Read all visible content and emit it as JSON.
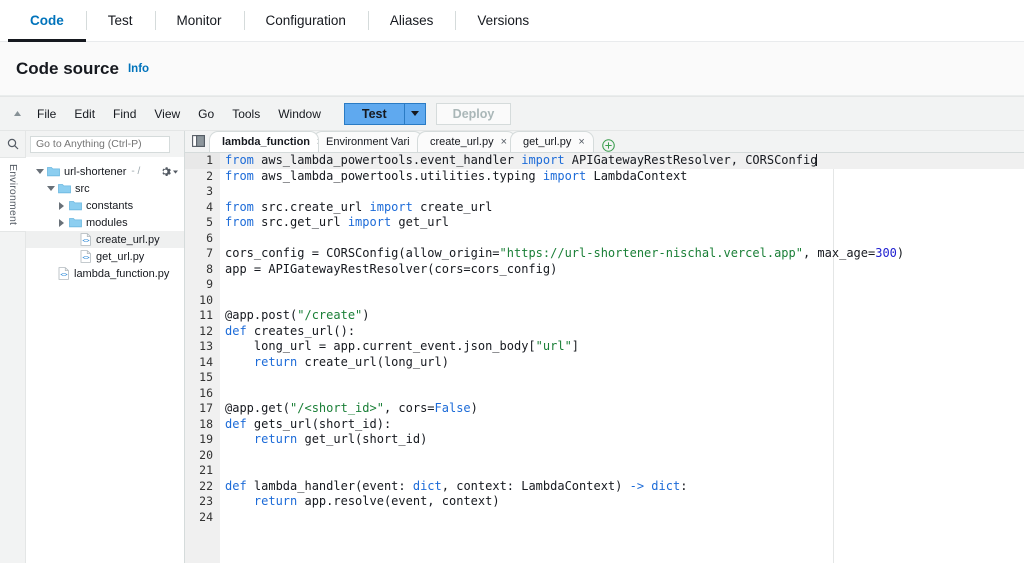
{
  "topnav": {
    "items": [
      {
        "label": "Code",
        "active": true
      },
      {
        "label": "Test",
        "active": false
      },
      {
        "label": "Monitor",
        "active": false
      },
      {
        "label": "Configuration",
        "active": false
      },
      {
        "label": "Aliases",
        "active": false
      },
      {
        "label": "Versions",
        "active": false
      }
    ]
  },
  "section": {
    "title": "Code source",
    "info_label": "Info"
  },
  "menubar": {
    "items": [
      "File",
      "Edit",
      "Find",
      "View",
      "Go",
      "Tools",
      "Window"
    ],
    "test_label": "Test",
    "deploy_label": "Deploy"
  },
  "rail": {
    "environment_label": "Environment"
  },
  "tree": {
    "search_placeholder": "Go to Anything (Ctrl-P)",
    "root": {
      "label": "url-shortener",
      "sub": "- /"
    },
    "items": [
      {
        "label": "src",
        "type": "folder",
        "depth": 1,
        "expanded": true,
        "selected": false
      },
      {
        "label": "constants",
        "type": "folder",
        "depth": 2,
        "expanded": false,
        "selected": false
      },
      {
        "label": "modules",
        "type": "folder",
        "depth": 2,
        "expanded": false,
        "selected": false
      },
      {
        "label": "create_url.py",
        "type": "file",
        "depth": 3,
        "expanded": false,
        "selected": true
      },
      {
        "label": "get_url.py",
        "type": "file",
        "depth": 3,
        "expanded": false,
        "selected": false
      },
      {
        "label": "lambda_function.py",
        "type": "file",
        "depth": 1,
        "expanded": false,
        "selected": false
      }
    ]
  },
  "editor": {
    "tabs": [
      {
        "label": "lambda_function",
        "active": true,
        "modified": false
      },
      {
        "label": "Environment Vari",
        "active": false,
        "modified": true
      },
      {
        "label": "create_url.py",
        "active": false,
        "modified": false
      },
      {
        "label": "get_url.py",
        "active": false,
        "modified": false
      }
    ],
    "add_tab_label": "+",
    "line_count": 24,
    "current_line": 1,
    "lines": [
      {
        "n": 1,
        "tokens": [
          {
            "t": "from ",
            "c": "kw"
          },
          {
            "t": "aws_lambda_powertools.event_handler ",
            "c": ""
          },
          {
            "t": "import ",
            "c": "kw"
          },
          {
            "t": "APIGatewayRestResolver, CORSConfig",
            "c": ""
          }
        ]
      },
      {
        "n": 2,
        "tokens": [
          {
            "t": "from ",
            "c": "kw"
          },
          {
            "t": "aws_lambda_powertools.utilities.typing ",
            "c": ""
          },
          {
            "t": "import ",
            "c": "kw"
          },
          {
            "t": "LambdaContext",
            "c": ""
          }
        ]
      },
      {
        "n": 3,
        "tokens": []
      },
      {
        "n": 4,
        "tokens": [
          {
            "t": "from ",
            "c": "kw"
          },
          {
            "t": "src.create_url ",
            "c": ""
          },
          {
            "t": "import ",
            "c": "kw"
          },
          {
            "t": "create_url",
            "c": ""
          }
        ]
      },
      {
        "n": 5,
        "tokens": [
          {
            "t": "from ",
            "c": "kw"
          },
          {
            "t": "src.get_url ",
            "c": ""
          },
          {
            "t": "import ",
            "c": "kw"
          },
          {
            "t": "get_url",
            "c": ""
          }
        ]
      },
      {
        "n": 6,
        "tokens": []
      },
      {
        "n": 7,
        "tokens": [
          {
            "t": "cors_config = CORSConfig(allow_origin=",
            "c": ""
          },
          {
            "t": "\"https://url-shortener-nischal.vercel.app\"",
            "c": "str"
          },
          {
            "t": ", max_age=",
            "c": ""
          },
          {
            "t": "300",
            "c": "num"
          },
          {
            "t": ")",
            "c": ""
          }
        ]
      },
      {
        "n": 8,
        "tokens": [
          {
            "t": "app = APIGatewayRestResolver(cors=cors_config)",
            "c": ""
          }
        ]
      },
      {
        "n": 9,
        "tokens": []
      },
      {
        "n": 10,
        "tokens": []
      },
      {
        "n": 11,
        "tokens": [
          {
            "t": "@app.post(",
            "c": ""
          },
          {
            "t": "\"/create\"",
            "c": "str"
          },
          {
            "t": ")",
            "c": ""
          }
        ]
      },
      {
        "n": 12,
        "tokens": [
          {
            "t": "def ",
            "c": "kw"
          },
          {
            "t": "creates_url",
            "c": "fn"
          },
          {
            "t": "():",
            "c": ""
          }
        ]
      },
      {
        "n": 13,
        "tokens": [
          {
            "t": "    long_url = app.current_event.json_body[",
            "c": ""
          },
          {
            "t": "\"url\"",
            "c": "str"
          },
          {
            "t": "]",
            "c": ""
          }
        ]
      },
      {
        "n": 14,
        "tokens": [
          {
            "t": "    ",
            "c": ""
          },
          {
            "t": "return ",
            "c": "kw"
          },
          {
            "t": "create_url(long_url)",
            "c": ""
          }
        ]
      },
      {
        "n": 15,
        "tokens": []
      },
      {
        "n": 16,
        "tokens": []
      },
      {
        "n": 17,
        "tokens": [
          {
            "t": "@app.get(",
            "c": ""
          },
          {
            "t": "\"/<short_id>\"",
            "c": "str"
          },
          {
            "t": ", cors=",
            "c": ""
          },
          {
            "t": "False",
            "c": "kw2"
          },
          {
            "t": ")",
            "c": ""
          }
        ]
      },
      {
        "n": 18,
        "tokens": [
          {
            "t": "def ",
            "c": "kw"
          },
          {
            "t": "gets_url",
            "c": "fn"
          },
          {
            "t": "(short_id):",
            "c": ""
          }
        ]
      },
      {
        "n": 19,
        "tokens": [
          {
            "t": "    ",
            "c": ""
          },
          {
            "t": "return ",
            "c": "kw"
          },
          {
            "t": "get_url(short_id)",
            "c": ""
          }
        ]
      },
      {
        "n": 20,
        "tokens": []
      },
      {
        "n": 21,
        "tokens": []
      },
      {
        "n": 22,
        "tokens": [
          {
            "t": "def ",
            "c": "kw"
          },
          {
            "t": "lambda_handler",
            "c": "fn"
          },
          {
            "t": "(event: ",
            "c": ""
          },
          {
            "t": "dict",
            "c": "kw2"
          },
          {
            "t": ", context: LambdaContext) ",
            "c": ""
          },
          {
            "t": "-> ",
            "c": "kw"
          },
          {
            "t": "dict",
            "c": "kw2"
          },
          {
            "t": ":",
            "c": ""
          }
        ]
      },
      {
        "n": 23,
        "tokens": [
          {
            "t": "    ",
            "c": ""
          },
          {
            "t": "return ",
            "c": "kw"
          },
          {
            "t": "app.resolve(event, context)",
            "c": ""
          }
        ]
      },
      {
        "n": 24,
        "tokens": []
      }
    ]
  },
  "colors": {
    "accent_blue": "#0073bb",
    "active_tab_underline": "#16191f",
    "test_button": "#5fa9ef",
    "string_green": "#1a7f37",
    "keyword_blue": "#1c6bd8",
    "number_blue": "#2020d0"
  }
}
